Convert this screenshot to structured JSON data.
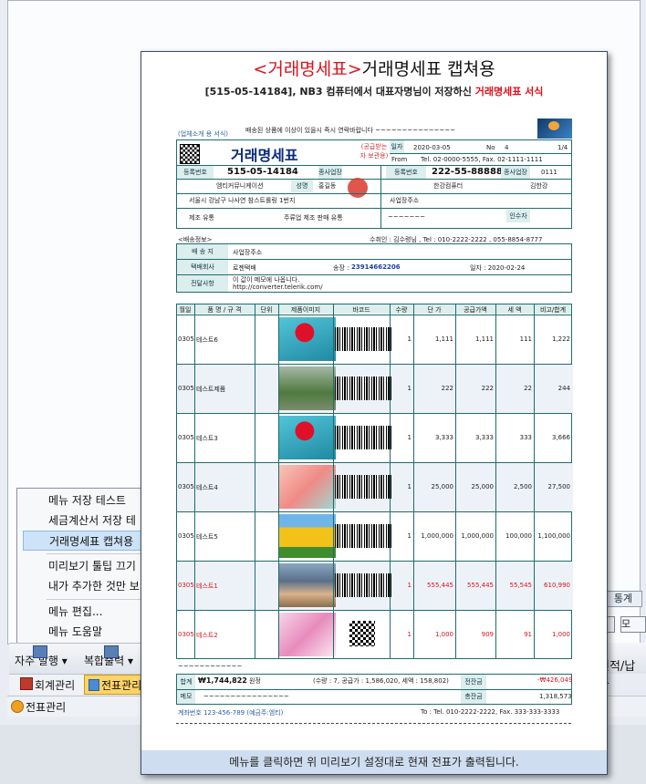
{
  "app": {
    "right_tab": "통계",
    "right_ctl": "모",
    "right_label": "견적/납품"
  },
  "context_menu": {
    "items": [
      "메뉴 저장 테스트",
      "세금계산서 저장 테",
      "거래명세표 캡쳐용",
      "미리보기 툴팁 끄기",
      "내가 추가한 것만 보",
      "메뉴 편집...",
      "메뉴 도움말"
    ],
    "selected_index": 2
  },
  "toolbar": {
    "frequent": "자주 발행",
    "composite": "복합출력"
  },
  "navbar": {
    "accounting": "회계관리",
    "voucher": "전표관리"
  },
  "statusbar": {
    "voucher": "전표관리"
  },
  "popup": {
    "title_tag": "<거래명세표>",
    "title_rest": "거래명세표 캡쳐용",
    "subtitle_part1": "[515-05-14184], NB3 컴퓨터에서 ",
    "subtitle_name": "대표자명",
    "subtitle_part2": "님이 저장하신 ",
    "subtitle_form": "거래명세표 서식",
    "footer": "메뉴를 클릭하면 위 미리보기 설정대로 현재 전표가 출력됩니다."
  },
  "doc": {
    "form_label": "(업체소개 용 서식)",
    "top_notice": "배송된 상품에 이상이 있을시 즉시 연락바랍니다 ~~~~~~~~~~~~~~~",
    "title": "거래명세표",
    "copy_label": "(공급받는자 보관용)",
    "date_label": "일자",
    "date": "2020-03-05",
    "no_label": "No",
    "no": "4",
    "page": "1/4",
    "from_label": "From",
    "from_value": "Tel. 02-0000-5555, Fax. 02-1111-1111",
    "supplier_reg_label": "등록번호",
    "supplier_reg": "515-05-14184",
    "branch_label": "종사업장",
    "buyer_reg": "222-55-88888",
    "buyer_branch": "0111",
    "supplier_company": "엠티커뮤니케이션",
    "supplier_name_label": "성명",
    "supplier_name": "홍길동",
    "buyer_company": "한강컴퓨터",
    "buyer_name": "김한강",
    "supplier_addr": "서울시 강남구 나사연 참스트롤링 1번지",
    "buyer_addr": "사업장주소",
    "supplier_type": "제조 유통",
    "supplier_item": "주류업 제조 판매 유통",
    "buyer_type": "~~~~~~~",
    "buyer_item_label": "인수자",
    "delivery_title": "<배송정보>",
    "receiver": "수취인 : 김수령님 , Tel : 010-2222-2222 , 055-8854-8777",
    "delivery_rows": [
      {
        "label": "배 송 지",
        "value": "사업장주소"
      },
      {
        "label": "택배회사",
        "value": "로젠택배",
        "extra_label": "송장 :",
        "extra": "23914662206",
        "date_label": "일자 : 2020-02-24"
      },
      {
        "label": "전달사항",
        "value": "이 값이 메모에 나옵니다. http://converter.telerik.com/"
      }
    ],
    "columns": [
      "월일",
      "품 명 / 규 격",
      "단위",
      "제품이미지",
      "바코드",
      "수량",
      "단 가",
      "공급가액",
      "세 액",
      "비고/합계"
    ],
    "rows": [
      {
        "date": "0305",
        "name": "테스트6",
        "qty": "1",
        "price": "1,111",
        "supply": "1,111",
        "tax": "111",
        "total": "1,222",
        "red": false,
        "img": "flower-red",
        "code": "barcode"
      },
      {
        "date": "0305",
        "name": "테스트제품",
        "qty": "1",
        "price": "222",
        "supply": "222",
        "tax": "22",
        "total": "244",
        "red": false,
        "img": "forest",
        "code": "barcode"
      },
      {
        "date": "0305",
        "name": "테스트3",
        "qty": "1",
        "price": "3,333",
        "supply": "3,333",
        "tax": "333",
        "total": "3,666",
        "red": false,
        "img": "flower-red",
        "code": "barcode"
      },
      {
        "date": "0305",
        "name": "테스트4",
        "qty": "1",
        "price": "25,000",
        "supply": "25,000",
        "tax": "2,500",
        "total": "27,500",
        "red": false,
        "img": "pink",
        "code": "barcode"
      },
      {
        "date": "0305",
        "name": "테스트5",
        "qty": "1",
        "price": "1,000,000",
        "supply": "1,000,000",
        "tax": "100,000",
        "total": "1,100,000",
        "red": false,
        "img": "tulips",
        "code": "barcode"
      },
      {
        "date": "0305",
        "name": "테스트1",
        "qty": "1",
        "price": "555,445",
        "supply": "555,445",
        "tax": "55,545",
        "total": "610,990",
        "red": true,
        "img": "child",
        "code": "barcode"
      },
      {
        "date": "0305",
        "name": "테스트2",
        "qty": "1",
        "price": "1,000",
        "supply": "909",
        "tax": "91",
        "total": "1,000",
        "red": true,
        "img": "blossom",
        "code": "qr"
      }
    ],
    "dash_line": "~~~~~~~~~~~~",
    "sum_label": "합계",
    "sum_amount": "₩1,744,822",
    "sum_tag": "원정",
    "sum_detail": "(수량 : 7, 공급가 : 1,586,020, 세액 : 158,802)",
    "prev_balance_label": "전잔금",
    "prev_balance": "-₩426,049",
    "memo_label": "메모",
    "memo": "~~~~~~~~~~~~~~~~",
    "balance_label": "총잔금",
    "balance": "1,318,573",
    "account_note": "계좌번호 123-456-789 (예금주:엠티)",
    "to_contact": "To : Tel. 010-2222-2222,  Fax. 333-333-3333"
  }
}
